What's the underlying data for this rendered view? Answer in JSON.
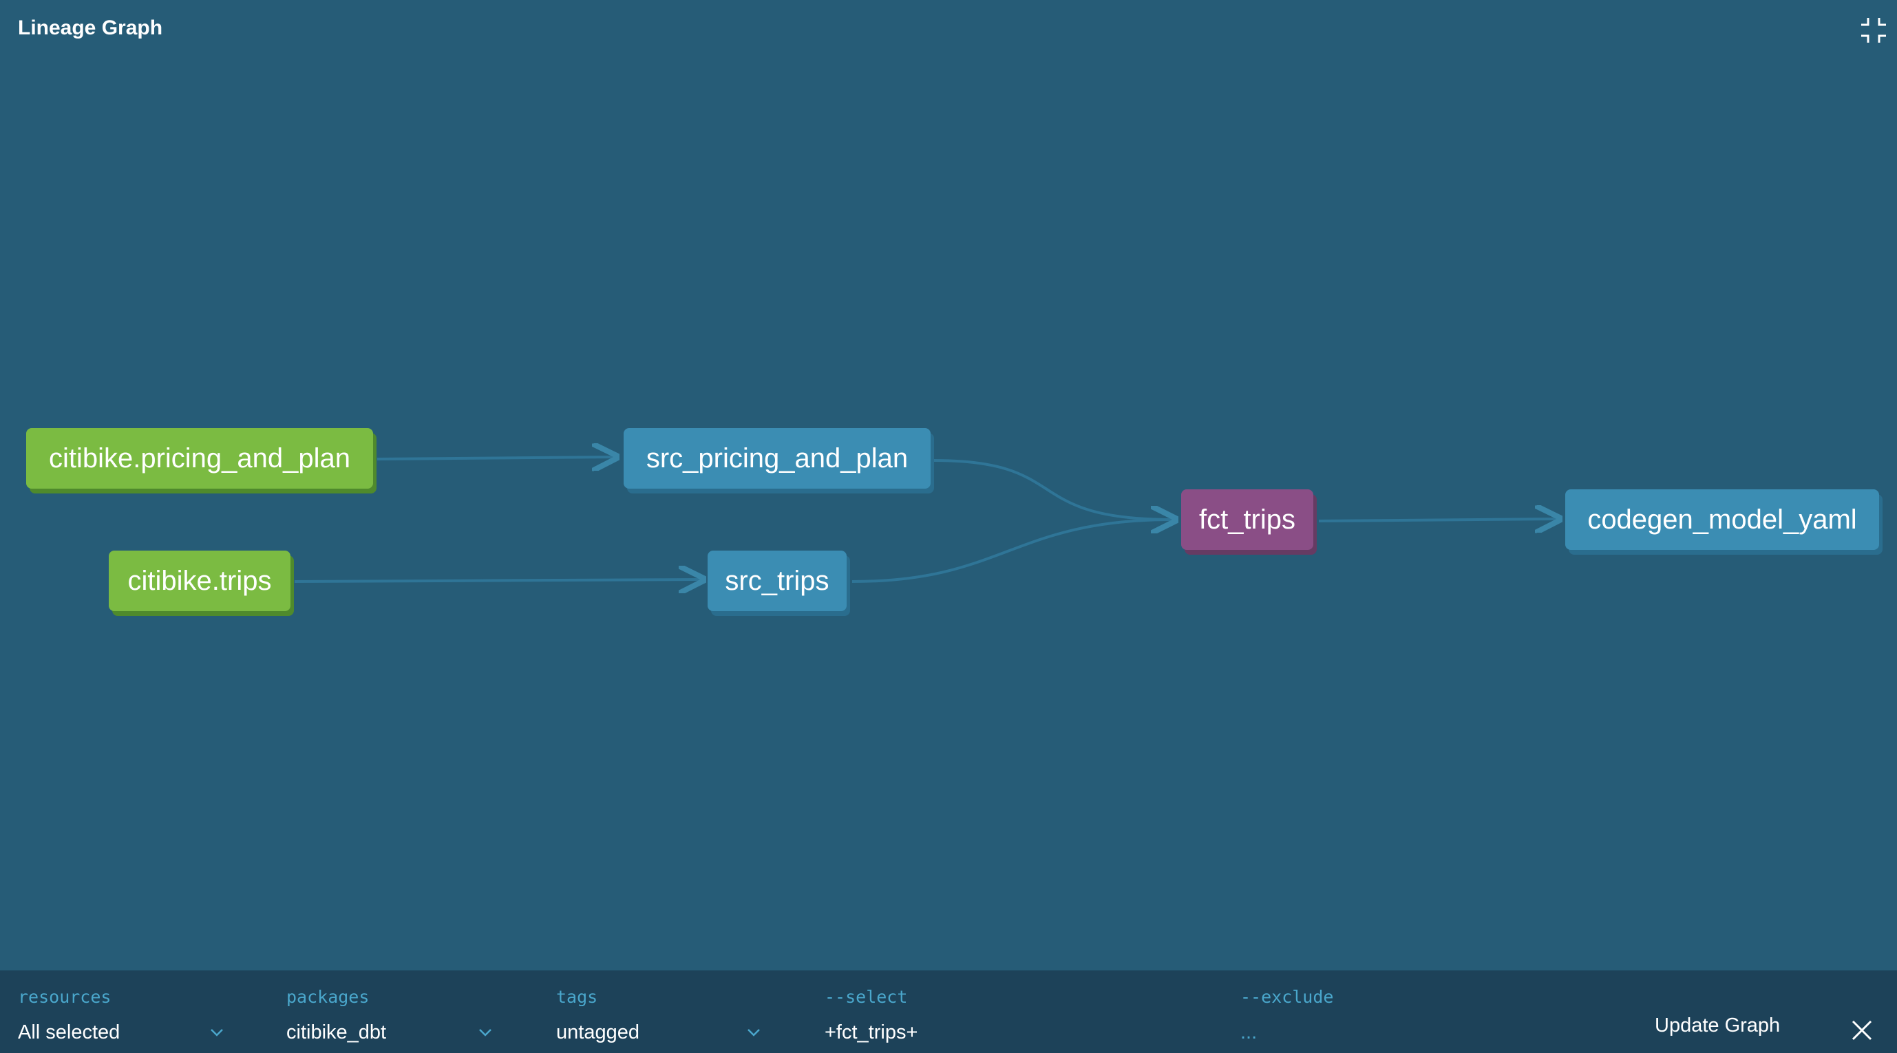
{
  "header": {
    "title": "Lineage Graph",
    "collapse_icon": "collapse-icon"
  },
  "graph": {
    "nodes": [
      {
        "id": "citibike_pricing",
        "label": "citibike.pricing_and_plan",
        "type": "source",
        "color": "#7bbb42"
      },
      {
        "id": "citibike_trips",
        "label": "citibike.trips",
        "type": "source",
        "color": "#7bbb42"
      },
      {
        "id": "src_pricing",
        "label": "src_pricing_and_plan",
        "type": "model",
        "color": "#3b8db3"
      },
      {
        "id": "src_trips",
        "label": "src_trips",
        "type": "model",
        "color": "#3b8db3"
      },
      {
        "id": "fct_trips",
        "label": "fct_trips",
        "type": "model-selected",
        "color": "#8a4e86"
      },
      {
        "id": "codegen",
        "label": "codegen_model_yaml",
        "type": "model",
        "color": "#3b8db3"
      }
    ],
    "edges": [
      [
        "citibike.pricing_and_plan",
        "src_pricing_and_plan"
      ],
      [
        "citibike.trips",
        "src_trips"
      ],
      [
        "src_pricing_and_plan",
        "fct_trips"
      ],
      [
        "src_trips",
        "fct_trips"
      ],
      [
        "fct_trips",
        "codegen_model_yaml"
      ]
    ]
  },
  "filters": {
    "resources": {
      "label": "resources",
      "value": "All selected"
    },
    "packages": {
      "label": "packages",
      "value": "citibike_dbt"
    },
    "tags": {
      "label": "tags",
      "value": "untagged"
    },
    "select": {
      "label": "--select",
      "value": "+fct_trips+"
    },
    "exclude": {
      "label": "--exclude",
      "value": "..."
    }
  },
  "actions": {
    "update_label": "Update Graph",
    "close_icon": "close-icon"
  }
}
